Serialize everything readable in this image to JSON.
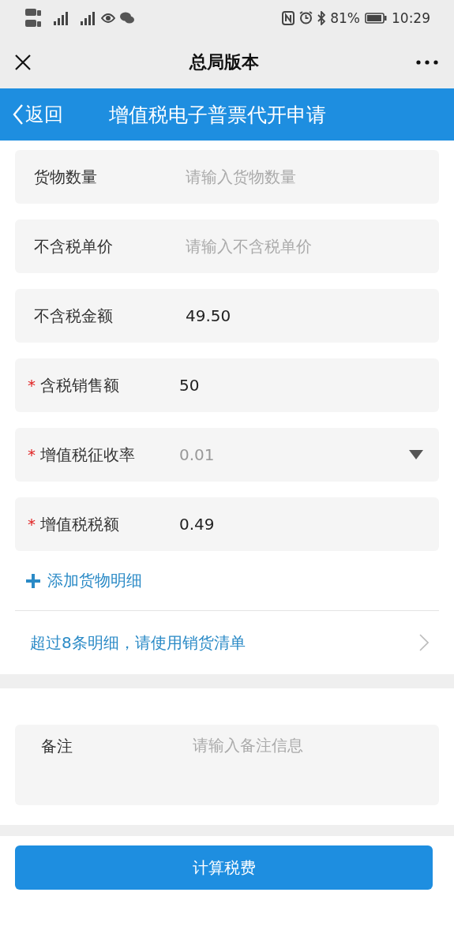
{
  "status_bar": {
    "battery": "81%",
    "time": "10:29"
  },
  "nav": {
    "title": "总局版本"
  },
  "header": {
    "back": "返回",
    "title": "增值税电子普票代开申请"
  },
  "fields": [
    {
      "kind": "input",
      "label": "货物数量",
      "required": false,
      "placeholder": "请输入货物数量"
    },
    {
      "kind": "input",
      "label": "不含税单价",
      "required": false,
      "placeholder": "请输入不含税单价"
    },
    {
      "kind": "input",
      "label": "不含税金额",
      "required": false,
      "value": "49.50"
    },
    {
      "kind": "input",
      "label": "含税销售额",
      "required": true,
      "required_mark": "*",
      "value": "50"
    },
    {
      "kind": "select",
      "label": "增值税征收率",
      "required": true,
      "required_mark": "*",
      "value": "0.01"
    },
    {
      "kind": "input",
      "label": "增值税税额",
      "required": true,
      "required_mark": "*",
      "value": "0.49"
    }
  ],
  "add_detail": "添加货物明细",
  "list_link": "超过8条明细，请使用销货清单",
  "remark": {
    "label": "备注",
    "placeholder": "请输入备注信息"
  },
  "submit": "计算税费"
}
